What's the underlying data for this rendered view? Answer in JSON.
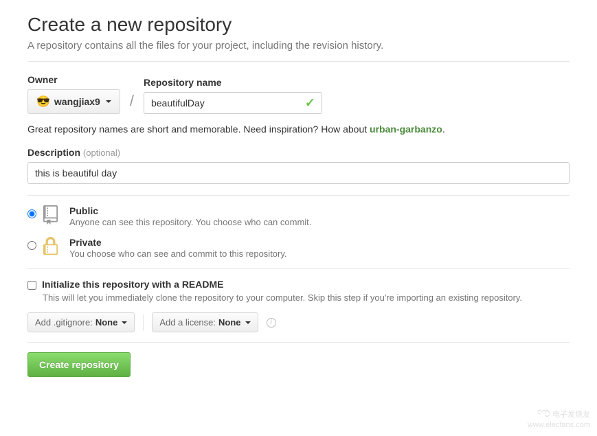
{
  "page": {
    "title": "Create a new repository",
    "subtitle": "A repository contains all the files for your project, including the revision history."
  },
  "owner": {
    "label": "Owner",
    "avatar_emoji": "😎",
    "username": "wangjiax9"
  },
  "repo": {
    "label": "Repository name",
    "value": "beautifulDay",
    "valid": true
  },
  "hint": {
    "prefix": "Great repository names are short and memorable. Need inspiration? How about ",
    "suggestion": "urban-garbanzo",
    "suffix": "."
  },
  "description": {
    "label": "Description",
    "optional_text": "(optional)",
    "value": "this is beautiful day"
  },
  "visibility": {
    "public": {
      "title": "Public",
      "sub": "Anyone can see this repository. You choose who can commit.",
      "selected": true
    },
    "private": {
      "title": "Private",
      "sub": "You choose who can see and commit to this repository.",
      "selected": false
    }
  },
  "readme": {
    "title": "Initialize this repository with a README",
    "sub": "This will let you immediately clone the repository to your computer. Skip this step if you're importing an existing repository.",
    "checked": false
  },
  "gitignore": {
    "prefix": "Add .gitignore: ",
    "value": "None"
  },
  "license": {
    "prefix": "Add a license: ",
    "value": "None"
  },
  "submit": {
    "label": "Create repository"
  },
  "watermark": {
    "text1": "电子发烧友",
    "text2": "www.elecfans.com"
  }
}
